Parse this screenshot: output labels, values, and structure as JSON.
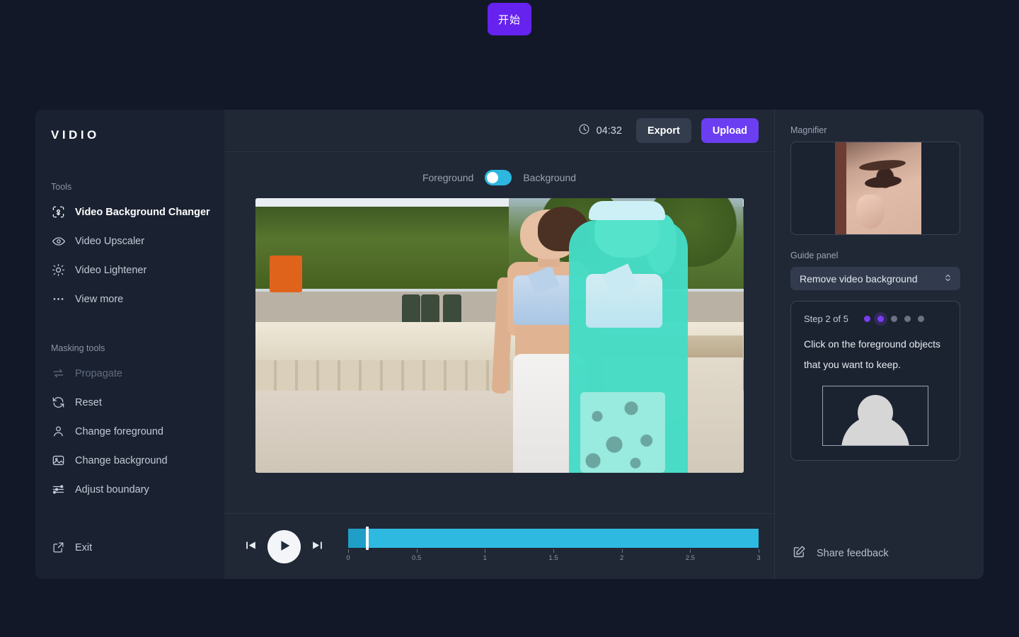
{
  "start_button": {
    "label": "开始"
  },
  "app": {
    "logo": "VIDIO",
    "sidebar": {
      "tools_label": "Tools",
      "tools": [
        {
          "label": "Video Background Changer",
          "icon": "background-changer-icon",
          "state": "active"
        },
        {
          "label": "Video Upscaler",
          "icon": "eye-icon",
          "state": "normal"
        },
        {
          "label": "Video Lightener",
          "icon": "sun-icon",
          "state": "normal"
        },
        {
          "label": "View more",
          "icon": "ellipsis-icon",
          "state": "normal"
        }
      ],
      "masking_label": "Masking tools",
      "masking": [
        {
          "label": "Propagate",
          "icon": "propagate-arrows-icon",
          "state": "disabled"
        },
        {
          "label": "Reset",
          "icon": "refresh-icon",
          "state": "normal"
        },
        {
          "label": "Change foreground",
          "icon": "person-icon",
          "state": "normal"
        },
        {
          "label": "Change background",
          "icon": "image-icon",
          "state": "normal"
        },
        {
          "label": "Adjust boundary",
          "icon": "sliders-icon",
          "state": "normal"
        }
      ],
      "exit": {
        "label": "Exit",
        "icon": "external-link-icon"
      }
    },
    "topbar": {
      "timer": "04:32",
      "timer_icon": "clock-icon",
      "export_label": "Export",
      "upload_label": "Upload"
    },
    "stage": {
      "toggle_left_label": "Foreground",
      "toggle_right_label": "Background",
      "toggle_state": "Foreground"
    },
    "player": {
      "prev_icon": "skip-previous-icon",
      "play_icon": "play-icon",
      "next_icon": "skip-next-icon",
      "playhead_position": 0.13,
      "duration": 3
    },
    "right_panel": {
      "magnifier_label": "Magnifier",
      "guide_panel_label": "Guide panel",
      "guide_select_value": "Remove video background",
      "guide_card": {
        "step_label": "Step 2 of 5",
        "current_step": 2,
        "total_steps": 5,
        "instruction": "Click on the foreground objects that you want to keep."
      },
      "feedback_label": "Share feedback",
      "feedback_icon": "edit-square-icon"
    }
  },
  "colors": {
    "page_background": "#121827",
    "panel_background": "#202836",
    "sidebar_background": "#1a2130",
    "accent_purple": "#6b3ef2",
    "accent_cyan": "#2eb9e0",
    "start_button": "#6622ee"
  },
  "timeline_ticks": [
    {
      "label": "0",
      "value": 0
    },
    {
      "label": "0.5",
      "value": 0.5
    },
    {
      "label": "1",
      "value": 1
    },
    {
      "label": "1.5",
      "value": 1.5
    },
    {
      "label": "2",
      "value": 2
    },
    {
      "label": "2.5",
      "value": 2.5
    },
    {
      "label": "3",
      "value": 3
    }
  ]
}
